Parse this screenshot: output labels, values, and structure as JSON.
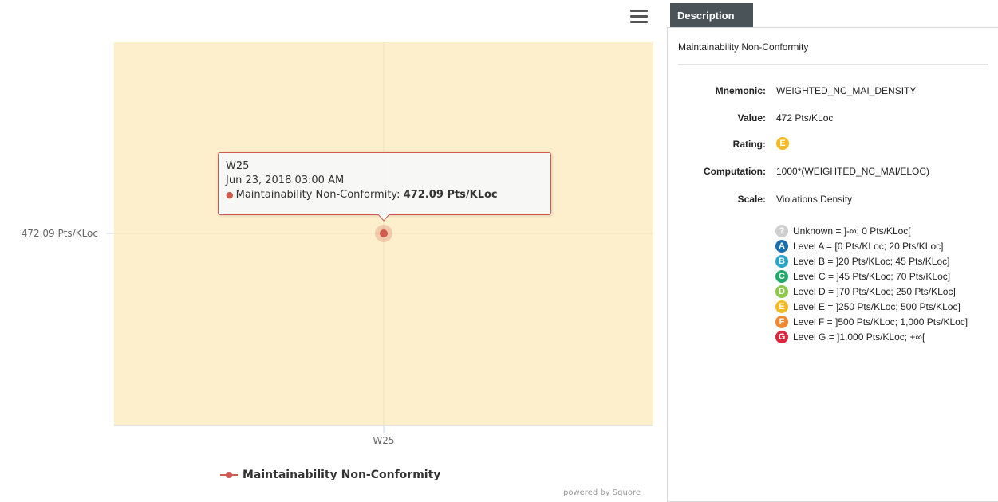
{
  "chart_data": {
    "type": "scatter",
    "title": "",
    "categories": [
      "W25"
    ],
    "series": [
      {
        "name": "Maintainability Non-Conformity",
        "values": [
          472.09
        ],
        "color": "#cf5a50"
      }
    ],
    "y_tick_labels": [
      "472.09 Pts/KLoc"
    ],
    "unit": "Pts/KLoc",
    "plot_background": "#fdefcb",
    "grid": true,
    "legend": "bottom-center"
  },
  "tooltip": {
    "title": "W25",
    "date": "Jun 23, 2018 03:00 AM",
    "series_label": "Maintainability Non-Conformity: ",
    "value": "472.09 Pts/KLoc"
  },
  "credits": "powered by Squore",
  "menu_icon": "hamburger-icon",
  "description": {
    "tab_label": "Description",
    "heading": "Maintainability Non-Conformity",
    "mnemonic_label": "Mnemonic:",
    "mnemonic": "WEIGHTED_NC_MAI_DENSITY",
    "value_label": "Value:",
    "value": "472 Pts/KLoc",
    "rating_label": "Rating:",
    "rating": {
      "letter": "E",
      "color": "#f6b921"
    },
    "computation_label": "Computation:",
    "computation": "1000*(WEIGHTED_NC_MAI/ELOC)",
    "scale_label": "Scale:",
    "scale": "Violations Density",
    "levels": [
      {
        "badge": "?",
        "color": "#cfcfcf",
        "text": "Unknown = ]-∞; 0 Pts/KLoc["
      },
      {
        "badge": "A",
        "color": "#1a6fae",
        "text": "Level A = [0 Pts/KLoc; 20 Pts/KLoc]"
      },
      {
        "badge": "B",
        "color": "#27a4c9",
        "text": "Level B = ]20 Pts/KLoc; 45 Pts/KLoc]"
      },
      {
        "badge": "C",
        "color": "#21a86b",
        "text": "Level C = ]45 Pts/KLoc; 70 Pts/KLoc]"
      },
      {
        "badge": "D",
        "color": "#8cc84b",
        "text": "Level D = ]70 Pts/KLoc; 250 Pts/KLoc]"
      },
      {
        "badge": "E",
        "color": "#f6b921",
        "text": "Level E = ]250 Pts/KLoc; 500 Pts/KLoc]"
      },
      {
        "badge": "F",
        "color": "#f1882f",
        "text": "Level F = ]500 Pts/KLoc; 1,000 Pts/KLoc]"
      },
      {
        "badge": "G",
        "color": "#d9283f",
        "text": "Level G = ]1,000 Pts/KLoc; +∞["
      }
    ]
  }
}
